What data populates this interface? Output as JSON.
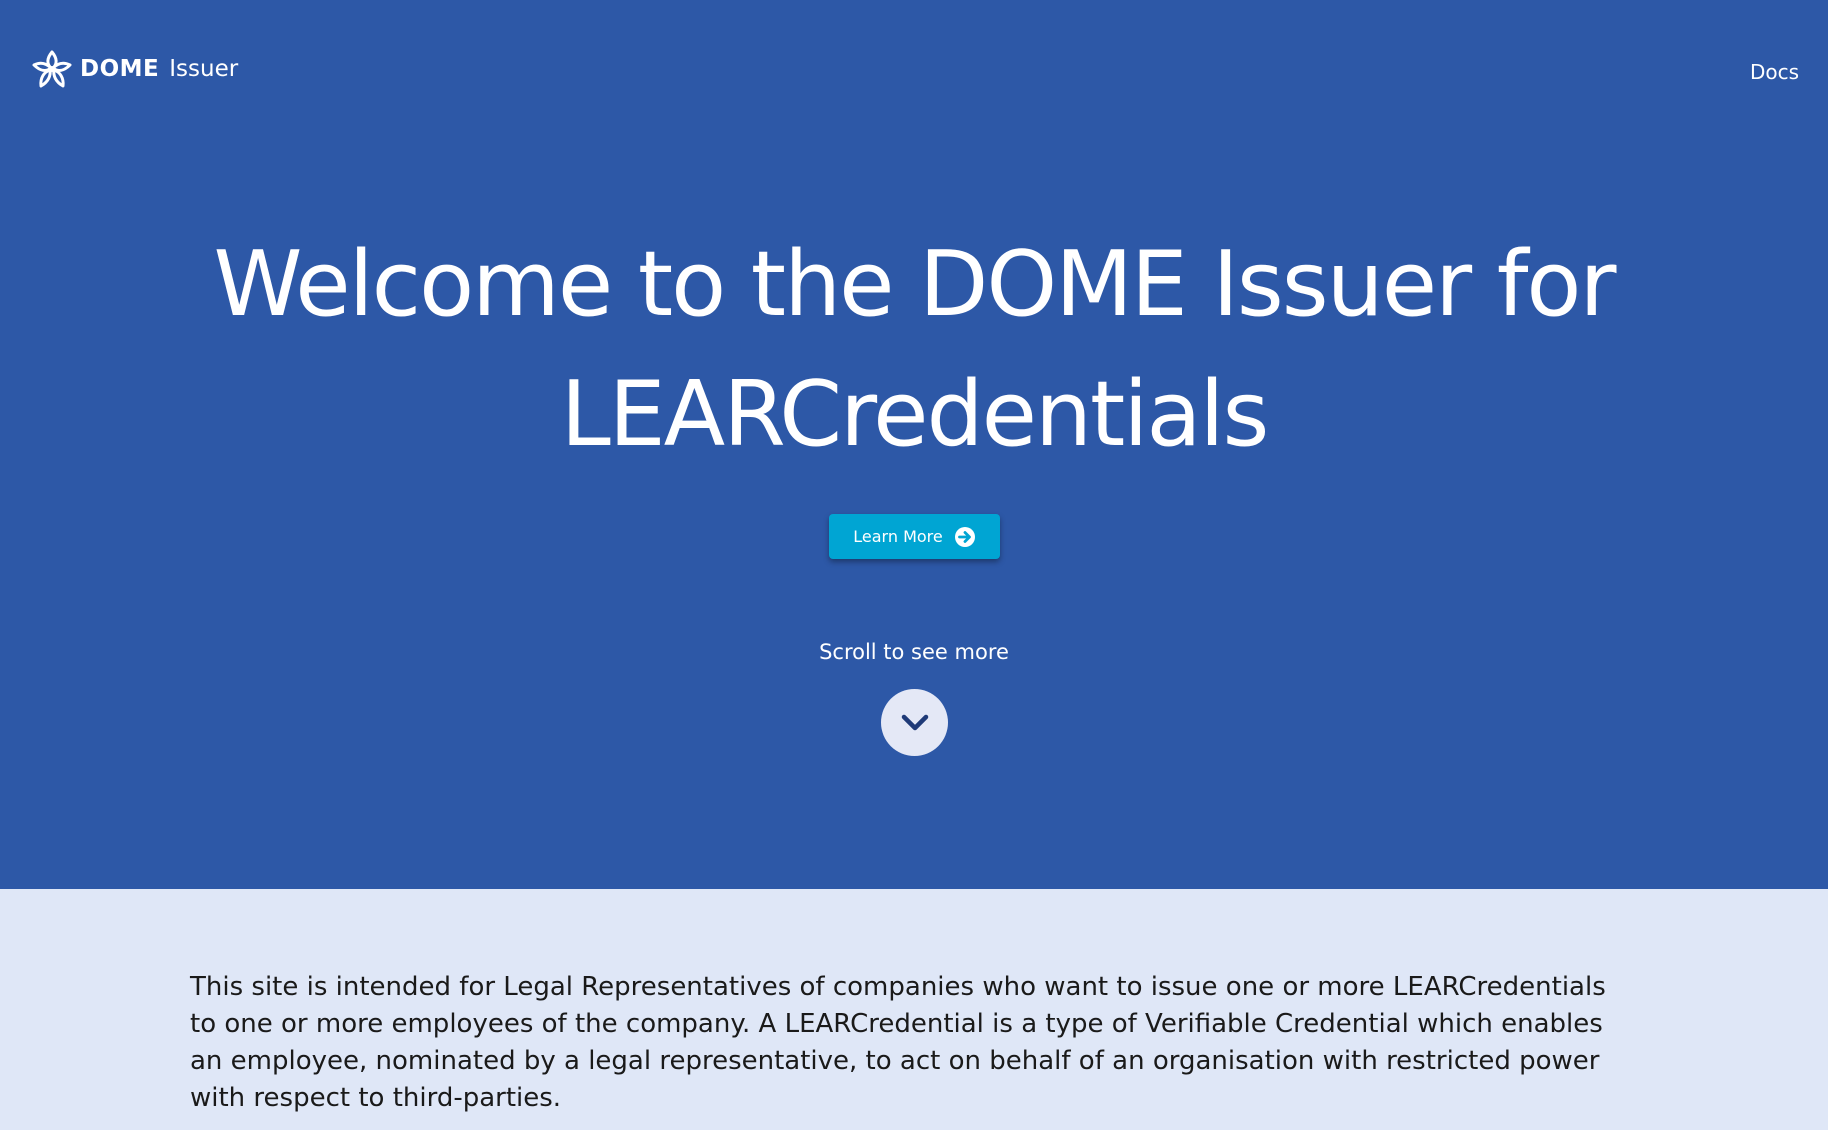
{
  "header": {
    "brand_name": "DOME",
    "brand_sub": "Issuer",
    "docs_label": "Docs"
  },
  "hero": {
    "title": "Welcome to the DOME Issuer for LEARCredentials",
    "learn_more_label": "Learn More",
    "scroll_label": "Scroll to see more"
  },
  "icons": {
    "logo": "dome-logo-icon",
    "learn_more": "arrow-right-circle-icon",
    "scroll": "chevron-down-icon"
  },
  "colors": {
    "hero_bg": "#2d58a7",
    "button_bg": "#00a5d3",
    "intro_bg": "#dfe7f7",
    "scroll_circle": "#e4e8f6",
    "chevron": "#1f3a78"
  },
  "intro": {
    "text": "This site is intended for Legal Representatives of companies who want to issue one or more LEARCredentials to one or more employees of the company. A LEARCredential is a type of Verifiable Credential which enables an employee, nominated by a legal representative, to act on behalf of an organisation with restricted power with respect to third-parties."
  }
}
